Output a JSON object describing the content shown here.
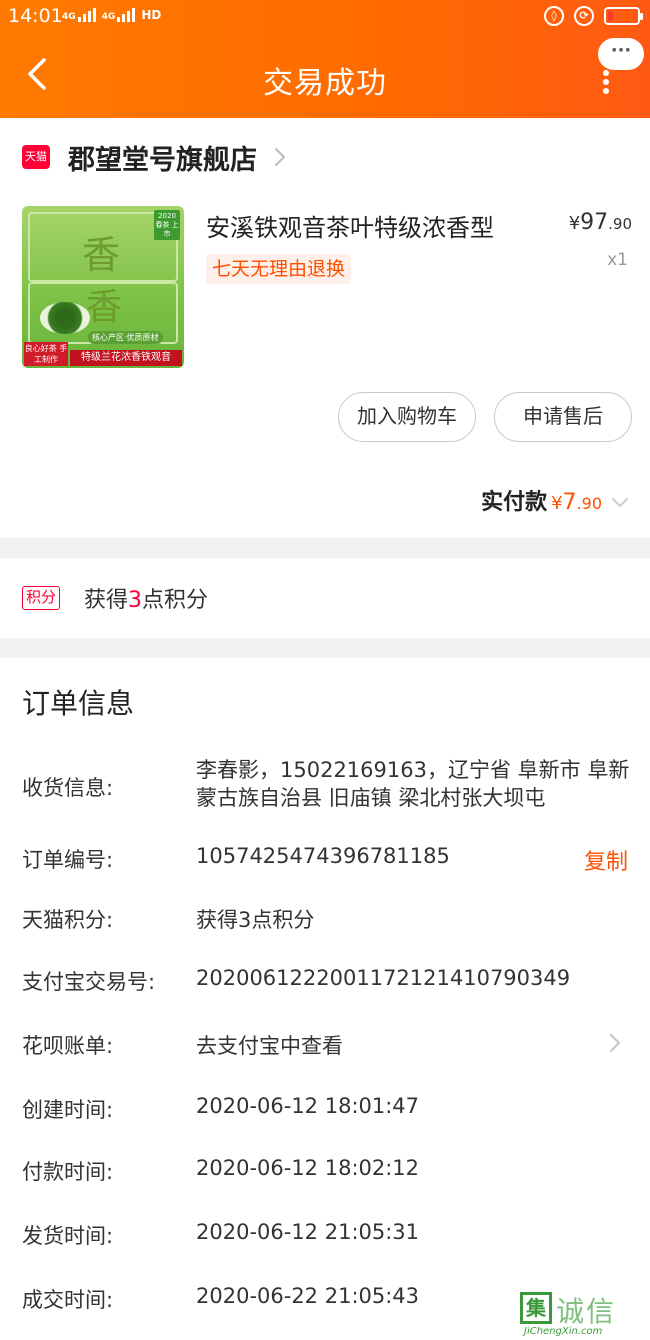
{
  "status_bar": {
    "time": "14:01",
    "network_1": "4G",
    "network_2": "4G",
    "network_3": "HD",
    "icons": [
      "vibrate-icon",
      "lock-rotation-icon",
      "battery-icon"
    ]
  },
  "header": {
    "title": "交易成功",
    "more_label": "···"
  },
  "store": {
    "badge": "天猫",
    "name": "郡望堂号旗舰店"
  },
  "product": {
    "title": "安溪铁观音茶叶特级浓香型",
    "return_policy": "七天无理由退换",
    "price_symbol": "¥",
    "price_int": "97",
    "price_dec": ".90",
    "quantity": "x1",
    "image": {
      "char1": "香",
      "char2": "香",
      "badge": "2020 春茶 上市",
      "sub": "核心产区·优质原材",
      "left_label": "良心好茶 手工制作",
      "bottom_label": "特级兰花浓香铁观音"
    }
  },
  "actions": {
    "add_cart": "加入购物车",
    "after_sale": "申请售后"
  },
  "payment": {
    "label": "实付款",
    "symbol": "¥",
    "int": "7",
    "dec": ".90"
  },
  "points": {
    "tag": "积分",
    "prefix": "获得",
    "count": "3",
    "suffix": "点积分"
  },
  "order": {
    "title": "订单信息",
    "shipping_label": "收货信息:",
    "shipping_value": "李春影，15022169163，辽宁省 阜新市 阜新蒙古族自治县 旧庙镇 梁北村张大坝屯",
    "order_no_label": "订单编号:",
    "order_no_value": "1057425474396781185",
    "copy_label": "复制",
    "tmall_points_label": "天猫积分:",
    "tmall_points_value": "获得3点积分",
    "alipay_label": "支付宝交易号:",
    "alipay_value": "2020061222001172121410790349",
    "huabei_label": "花呗账单:",
    "huabei_value": "去支付宝中查看",
    "created_label": "创建时间:",
    "created_value": "2020-06-12 18:01:47",
    "paid_label": "付款时间:",
    "paid_value": "2020-06-12 18:02:12",
    "shipped_label": "发货时间:",
    "shipped_value": "2020-06-12 21:05:31",
    "closed_label": "成交时间:",
    "closed_value": "2020-06-22 21:05:43"
  },
  "watermark": {
    "box_char": "集",
    "chars": "诚信",
    "site": "JiChengXin.com"
  },
  "colors": {
    "header_orange": "#ff6a00",
    "accent_orange": "#ff5000",
    "tmall_red": "#ff0036"
  }
}
